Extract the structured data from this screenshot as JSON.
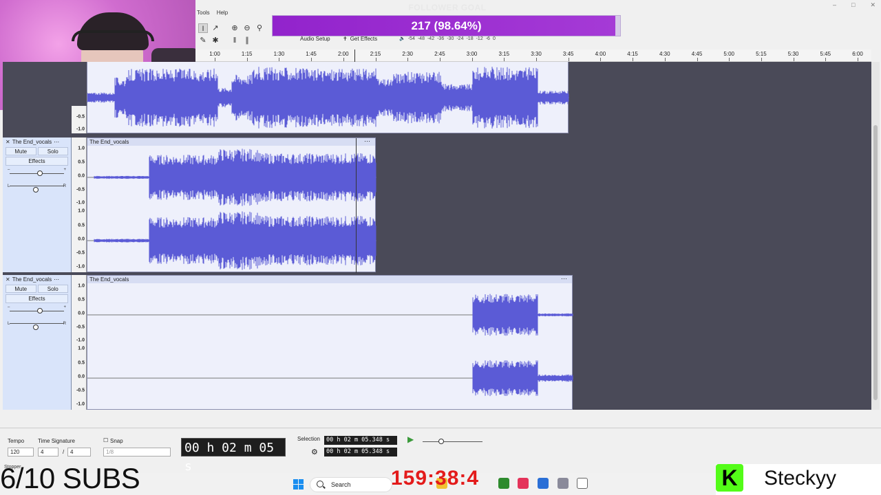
{
  "overlay": {
    "follower_title": "FOLLOWER GOAL",
    "follower_text": "217 (98.64%)",
    "follower_progress": 0.9864,
    "subs_text": "6/10 SUBS",
    "timer": "159:38:4",
    "streamer_name": "Steckyy",
    "kick_logo": "K",
    "stopper_label": "Stopper"
  },
  "menu": {
    "items": [
      "Tools",
      "Help"
    ]
  },
  "toolbar": {
    "audio_setup": "Audio Setup",
    "get_effects": "Get Effects",
    "meter_labels": [
      "-54",
      "-48",
      "-42",
      "-36",
      "-30",
      "-24",
      "-18",
      "-12",
      "-6",
      "0"
    ]
  },
  "ruler": {
    "ticks": [
      "1:00",
      "1:15",
      "1:30",
      "1:45",
      "2:00",
      "2:15",
      "2:30",
      "2:45",
      "3:00",
      "3:15",
      "3:30",
      "3:45",
      "4:00",
      "4:15",
      "4:30",
      "4:45",
      "5:00",
      "5:15",
      "5:30",
      "5:45",
      "6:00"
    ]
  },
  "tracks": [
    {
      "name": "The End_vocals",
      "clip_title": "The End_vocals",
      "mute": "Mute",
      "solo": "Solo",
      "effects": "Effects",
      "scale_top": [
        "1.0",
        "0.5",
        "0.0",
        "-0.5",
        "-1.0"
      ],
      "scale_bottom": [
        "1.0",
        "0.5",
        "0.0",
        "-0.5",
        "-1.0"
      ]
    },
    {
      "name": "The End_vocals",
      "clip_title": "The End_vocals",
      "mute": "Mute",
      "solo": "Solo",
      "effects": "Effects",
      "scale_top": [
        "1.0",
        "0.5",
        "0.0",
        "-0.5",
        "-1.0"
      ],
      "scale_bottom": [
        "1.0",
        "0.5",
        "0.0",
        "-0.5",
        "-1.0"
      ]
    }
  ],
  "top_track_scale": [
    "-0.5",
    "-1.0"
  ],
  "bottom": {
    "tempo_label": "Tempo",
    "tempo_value": "120",
    "timesig_label": "Time Signature",
    "timesig_num": "4",
    "timesig_den": "4",
    "snap_label": "Snap",
    "snap_value": "1/8",
    "big_time": "00 h 02 m 05 s",
    "selection_label": "Selection",
    "sel_start": "00 h 02 m 05.348 s",
    "sel_end": "00 h 02 m 05.348 s"
  },
  "taskbar": {
    "search_placeholder": "Search"
  },
  "colors": {
    "waveform": "#5b5bd6",
    "accent_purple": "#9223cc",
    "timer_red": "#e31b1b",
    "kick_green": "#53fc18"
  }
}
